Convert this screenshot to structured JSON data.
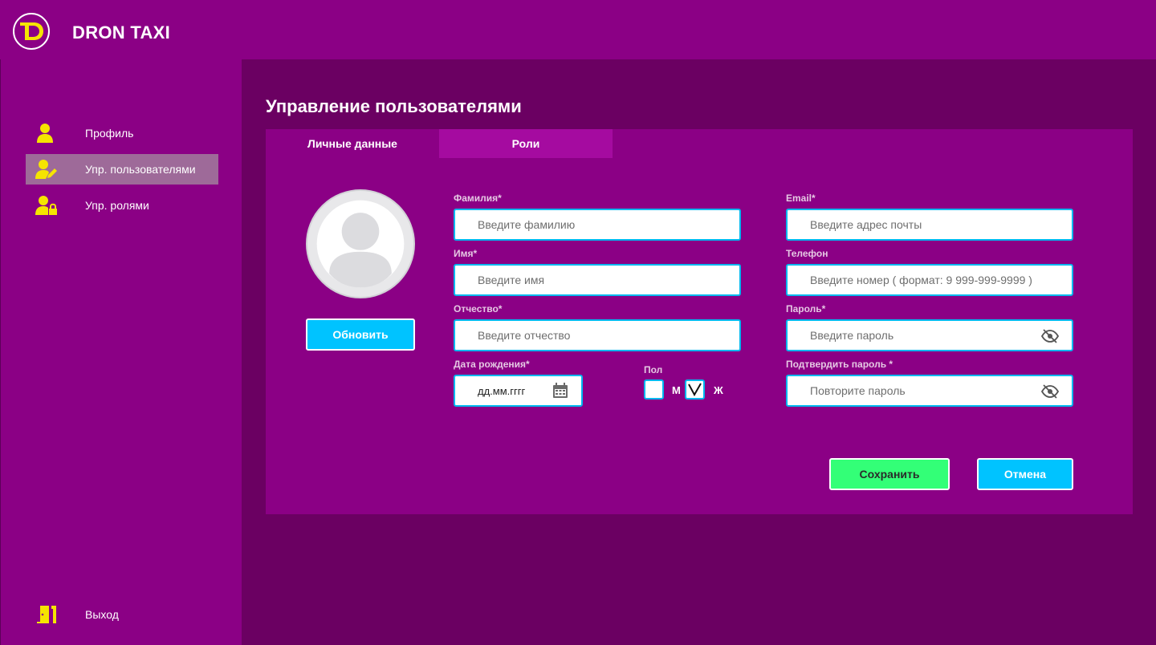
{
  "app": {
    "brand": "DRON TAXI"
  },
  "sidebar": {
    "items": [
      {
        "label": "Профиль",
        "icon": "user-icon"
      },
      {
        "label": "Упр. пользователями",
        "icon": "user-edit-icon"
      },
      {
        "label": "Упр. ролями",
        "icon": "user-lock-icon"
      }
    ],
    "logout": {
      "label": "Выход",
      "icon": "exit-door-icon"
    }
  },
  "page": {
    "title": "Управление пользователями"
  },
  "tabs": [
    {
      "label": "Личные данные"
    },
    {
      "label": "Роли"
    }
  ],
  "avatar": {
    "button": "Обновить"
  },
  "form": {
    "lastname": {
      "label": "Фамилия",
      "required": "*",
      "placeholder": "Введите фамилию"
    },
    "firstname": {
      "label": "Имя",
      "required": "*",
      "placeholder": "Введите имя"
    },
    "patronymic": {
      "label": "Отчество",
      "required": "*",
      "placeholder": "Введите отчество"
    },
    "birthdate": {
      "label": "Дата рождения",
      "required": "*",
      "value": "дд.мм.гггг"
    },
    "gender": {
      "label": "Пол",
      "male": "М",
      "female": "Ж",
      "selected": "female"
    },
    "email": {
      "label": "Email",
      "required": "*",
      "placeholder": "Введите адрес почты"
    },
    "phone": {
      "label": "Телефон",
      "placeholder": "Введите номер ( формат: 9 999-999-9999 )"
    },
    "password": {
      "label": "Пароль",
      "required": "*",
      "placeholder": "Введите пароль"
    },
    "confirm": {
      "label": "Подтвердить пароль",
      "required": " *",
      "placeholder": "Повторите пароль"
    }
  },
  "actions": {
    "save": "Сохранить",
    "cancel": "Отмена"
  },
  "colors": {
    "bg": "#8b0085",
    "main": "#6b0062",
    "accent_yellow": "#f5e400",
    "blue": "#00c3ff",
    "green": "#33ff77",
    "active_nav": "#9e6a99"
  }
}
